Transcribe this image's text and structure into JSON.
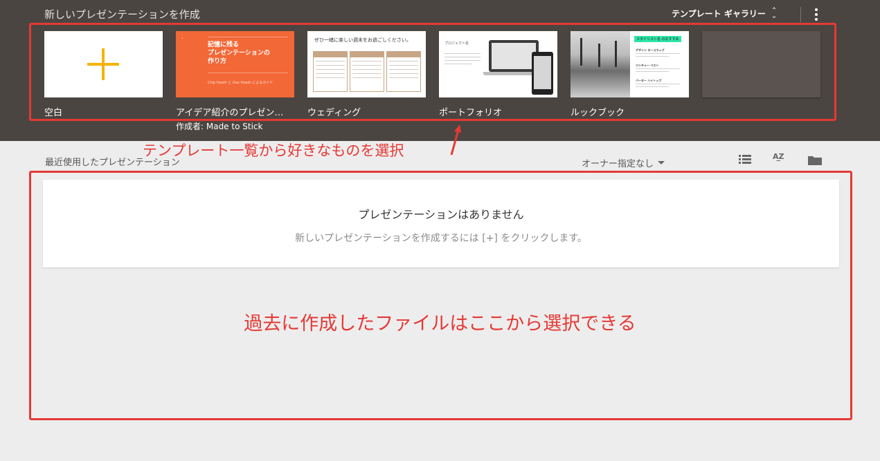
{
  "header": {
    "title": "新しいプレゼンテーションを作成",
    "gallery_label": "テンプレート ギャラリー",
    "updown_icon": "unfold-more-icon",
    "more_icon": "more-vert-icon"
  },
  "templates": [
    {
      "name": "空白"
    },
    {
      "name": "アイデア紹介のプレゼン…",
      "author": "作成者: Made to Stick",
      "thumb_title": "記憶に残る\nプレゼンテーションの\n作り方",
      "thumb_sub": "Chip Heath と Dan Heath によるガイド"
    },
    {
      "name": "ウェディング",
      "thumb_title": "ぜひ一緒に楽しい週末をお過ごしください。"
    },
    {
      "name": "ポートフォリオ",
      "thumb_title": "プロジェクト名"
    },
    {
      "name": "ルックブック",
      "thumb_tag": "スタイリスト名 のおすすめ",
      "thumb_items": [
        "デザイン ターコラップ",
        "ジンチャー ベスト",
        "バーター ハイトップ"
      ]
    },
    {
      "name": ""
    }
  ],
  "recent": {
    "label": "最近使用したプレゼンテーション",
    "owner_filter": "オーナー指定なし",
    "view_icons": [
      "list-view-icon",
      "sort-az-icon",
      "folder-icon"
    ],
    "sort_label": "AZ"
  },
  "empty_state": {
    "title": "プレゼンテーションはありません",
    "subtitle": "新しいプレゼンテーションを作成するには [+] をクリックします。"
  },
  "annotations": {
    "templates_note": "テンプレート一覧から好きなものを選択",
    "recent_note": "過去に作成したファイルはここから選択できる",
    "color": "#e53935"
  },
  "colors": {
    "header_bg": "#4b4541",
    "page_bg": "#ededed",
    "accent_plus": "#f4b400",
    "orange_template": "#f26837"
  }
}
